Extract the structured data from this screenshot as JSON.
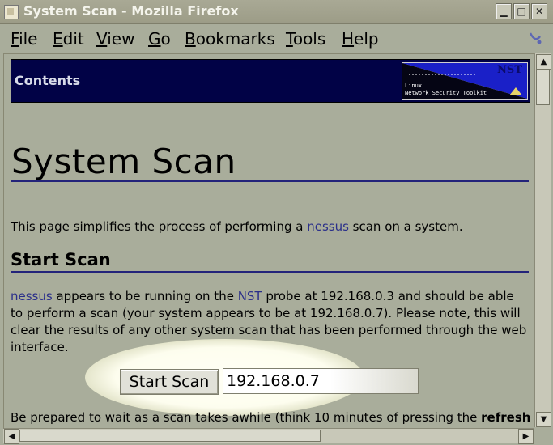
{
  "window": {
    "title": "System Scan - Mozilla Firefox",
    "buttons": {
      "minimize": "▁",
      "maximize": "□",
      "close": "✕"
    }
  },
  "menu": [
    {
      "accel": "F",
      "rest": "ile"
    },
    {
      "accel": "E",
      "rest": "dit"
    },
    {
      "accel": "V",
      "rest": "iew"
    },
    {
      "accel": "G",
      "rest": "o"
    },
    {
      "accel": "B",
      "rest": "ookmarks"
    },
    {
      "accel": "T",
      "rest": "ools"
    },
    {
      "accel": "H",
      "rest": "elp"
    }
  ],
  "banner": {
    "contents_label": "Contents",
    "logo": {
      "brand": "NST",
      "line1": "Linux",
      "line2": "Network Security Toolkit"
    }
  },
  "page": {
    "title": "System Scan",
    "intro": {
      "before": "This page simplifies the process of performing a ",
      "link": "nessus",
      "after": " scan on a system."
    },
    "section_title": "Start Scan",
    "body": {
      "link1": "nessus",
      "text1": " appears to be running on the ",
      "link2": "NST",
      "text2": " probe at 192.168.0.3 and should be able to perform a scan (your system appears to be at 192.168.0.7). Please note, this will clear the results of any other system scan that has been performed through the web interface."
    },
    "scan_button": "Start Scan",
    "target_ip": "192.168.0.7",
    "footer": {
      "text": "Be prepared to wait as a scan takes awhile (think 10 minutes of pressing the ",
      "bold": "refresh"
    }
  },
  "colors": {
    "background": "#a9ad9b",
    "banner": "#010246",
    "rule": "#23237a",
    "link": "#2a2f8a",
    "titlebar_text": "#f4f4ec"
  },
  "icons": [
    "app-icon",
    "minimize-icon",
    "maximize-icon",
    "close-icon",
    "throbber-icon",
    "nst-logo"
  ]
}
